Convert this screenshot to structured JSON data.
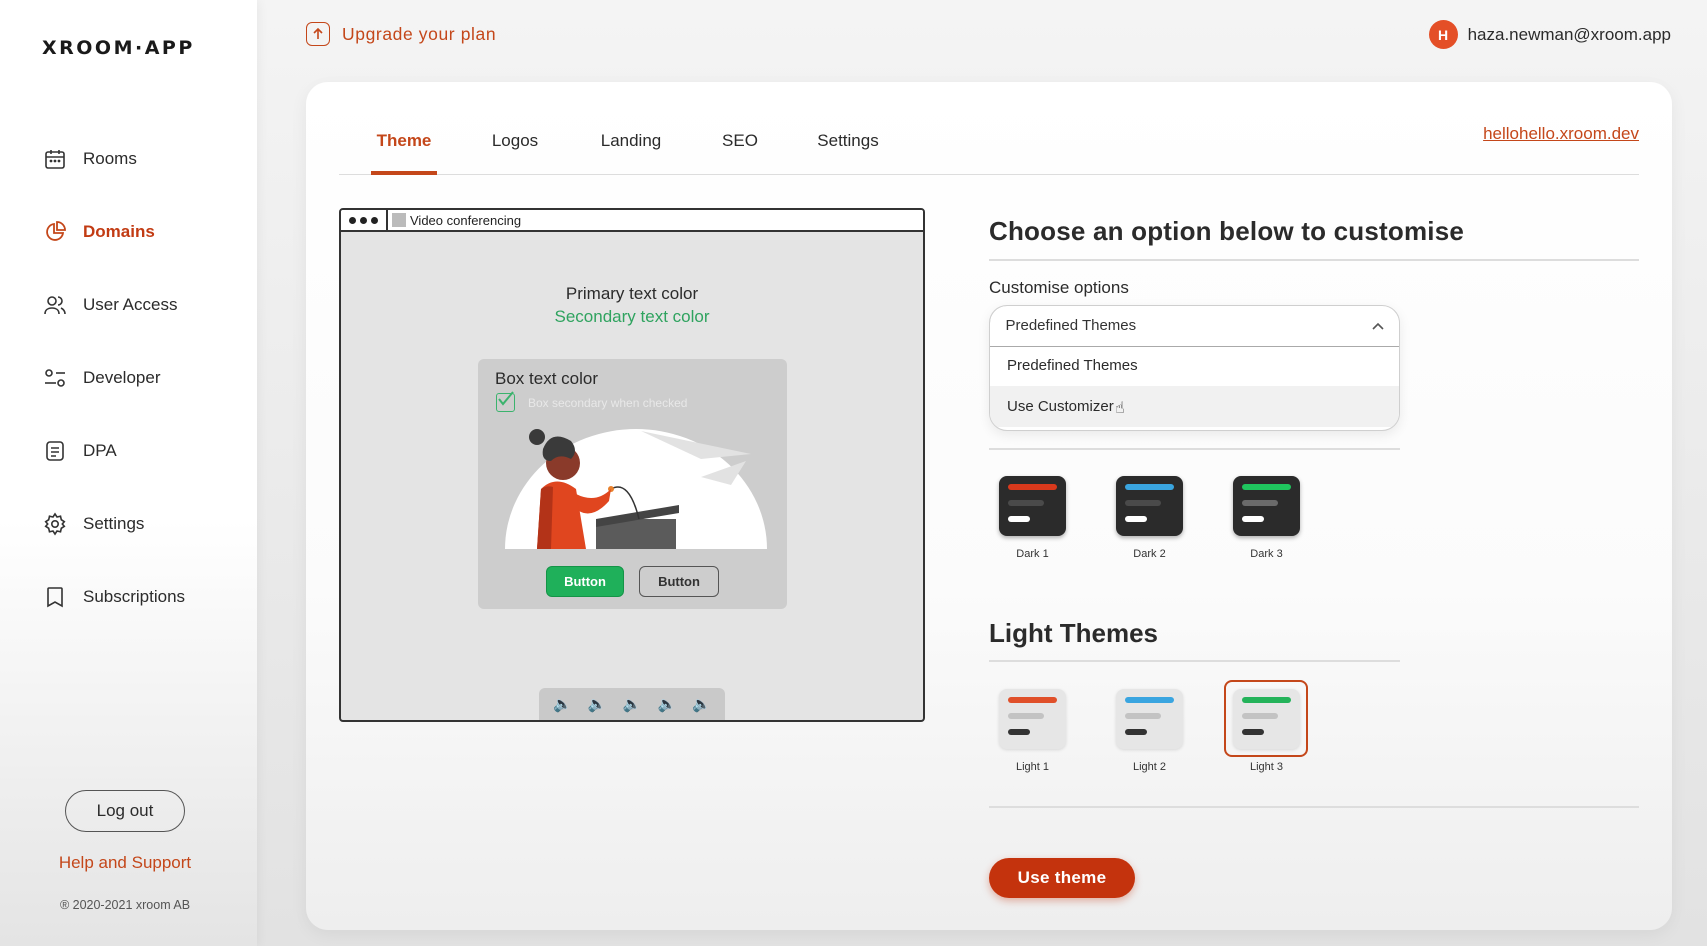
{
  "app": {
    "logo": "XROOM·APP"
  },
  "sidebar": {
    "items": [
      {
        "label": "Rooms",
        "icon": "calendar-icon"
      },
      {
        "label": "Domains",
        "icon": "pie-chart-icon",
        "active": true
      },
      {
        "label": "User Access",
        "icon": "users-icon"
      },
      {
        "label": "Developer",
        "icon": "sliders-icon"
      },
      {
        "label": "DPA",
        "icon": "document-icon"
      },
      {
        "label": "Settings",
        "icon": "gear-icon"
      },
      {
        "label": "Subscriptions",
        "icon": "bookmark-icon"
      }
    ],
    "logout_label": "Log out",
    "help_label": "Help and Support",
    "copyright": "® 2020-2021 xroom AB"
  },
  "topbar": {
    "upgrade_label": "Upgrade your plan",
    "user_initial": "H",
    "user_email": "haza.newman@xroom.app"
  },
  "tabs": [
    {
      "label": "Theme",
      "active": true
    },
    {
      "label": "Logos"
    },
    {
      "label": "Landing"
    },
    {
      "label": "SEO"
    },
    {
      "label": "Settings"
    }
  ],
  "domain_link": "hellohello.xroom.dev",
  "preview": {
    "window_title": "Video conferencing",
    "primary_text": "Primary text color",
    "secondary_text": "Secondary text color",
    "box_title": "Box text color",
    "box_secondary": "Box secondary when checked",
    "button_primary": "Button",
    "button_secondary": "Button",
    "controls": [
      "speaker-icon",
      "speaker-icon",
      "speaker-icon",
      "speaker-icon",
      "speaker-icon"
    ]
  },
  "customise": {
    "heading": "Choose an option below to customise",
    "options_label": "Customise options",
    "selected": "Predefined Themes",
    "options": [
      "Predefined Themes",
      "Use Customizer"
    ]
  },
  "dark_themes": [
    {
      "label": "Dark 1",
      "accent": "#d9391c"
    },
    {
      "label": "Dark 2",
      "accent": "#3aa5e0"
    },
    {
      "label": "Dark 3",
      "accent": "#1fc65e"
    }
  ],
  "light_heading": "Light Themes",
  "light_themes": [
    {
      "label": "Light 1",
      "accent": "#e0502a"
    },
    {
      "label": "Light 2",
      "accent": "#3aa5e0"
    },
    {
      "label": "Light 3",
      "accent": "#24b35a",
      "selected": true
    }
  ],
  "use_theme_label": "Use theme",
  "colors": {
    "brand": "#c4471a",
    "button": "#c4330d"
  }
}
